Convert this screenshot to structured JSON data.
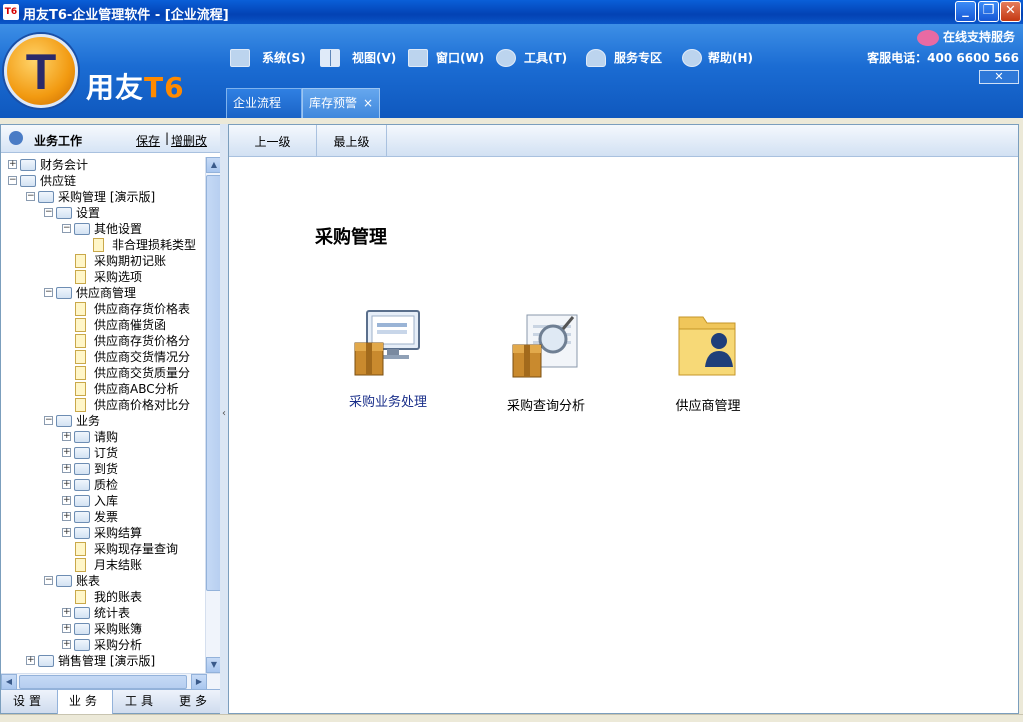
{
  "window": {
    "app_icon": "T6",
    "title": "用友T6-企业管理软件 - [企业流程]",
    "min_icon": "minimize-icon",
    "max_icon": "restore-icon",
    "close_icon": "close-icon"
  },
  "header": {
    "logo_letter": "T",
    "logo_text": "用友",
    "logo_text_brand": "T6",
    "menus": [
      {
        "label": "系统(S)",
        "icon": "monitor-icon"
      },
      {
        "label": "视图(V)",
        "icon": "grid-icon"
      },
      {
        "label": "窗口(W)",
        "icon": "window-icon"
      },
      {
        "label": "工具(T)",
        "icon": "gear-icon"
      },
      {
        "label": "服务专区",
        "icon": "user-icon"
      },
      {
        "label": "帮助(H)",
        "icon": "help-icon"
      }
    ],
    "online_service": "在线支持服务",
    "hotline": "客服电话：400 6600 566",
    "close_label": "✕"
  },
  "tabs": [
    {
      "label": "企业流程",
      "active": true
    },
    {
      "label": "库存预警",
      "active": false,
      "close": "×"
    }
  ],
  "left_panel": {
    "title": "业务工作",
    "save": "保存",
    "separator": "|",
    "edit": "增删改",
    "tree": [
      {
        "label": "财务会计",
        "level": 0,
        "expand": "+",
        "icon": "folder"
      },
      {
        "label": "供应链",
        "level": 0,
        "expand": "−",
        "icon": "folder"
      },
      {
        "label": "采购管理 [演示版]",
        "level": 1,
        "expand": "−",
        "icon": "folder"
      },
      {
        "label": "设置",
        "level": 2,
        "expand": "−",
        "icon": "folder"
      },
      {
        "label": "其他设置",
        "level": 3,
        "expand": "−",
        "icon": "folder"
      },
      {
        "label": "非合理损耗类型",
        "level": 4,
        "expand": "",
        "icon": "doc"
      },
      {
        "label": "采购期初记账",
        "level": 3,
        "expand": "",
        "icon": "doc"
      },
      {
        "label": "采购选项",
        "level": 3,
        "expand": "",
        "icon": "doc"
      },
      {
        "label": "供应商管理",
        "level": 2,
        "expand": "−",
        "icon": "folder"
      },
      {
        "label": "供应商存货价格表",
        "level": 3,
        "expand": "",
        "icon": "doc"
      },
      {
        "label": "供应商催货函",
        "level": 3,
        "expand": "",
        "icon": "doc"
      },
      {
        "label": "供应商存货价格分",
        "level": 3,
        "expand": "",
        "icon": "doc"
      },
      {
        "label": "供应商交货情况分",
        "level": 3,
        "expand": "",
        "icon": "doc"
      },
      {
        "label": "供应商交货质量分",
        "level": 3,
        "expand": "",
        "icon": "doc"
      },
      {
        "label": "供应商ABC分析",
        "level": 3,
        "expand": "",
        "icon": "doc"
      },
      {
        "label": "供应商价格对比分",
        "level": 3,
        "expand": "",
        "icon": "doc"
      },
      {
        "label": "业务",
        "level": 2,
        "expand": "−",
        "icon": "folder"
      },
      {
        "label": "请购",
        "level": 3,
        "expand": "+",
        "icon": "folder"
      },
      {
        "label": "订货",
        "level": 3,
        "expand": "+",
        "icon": "folder"
      },
      {
        "label": "到货",
        "level": 3,
        "expand": "+",
        "icon": "folder"
      },
      {
        "label": "质检",
        "level": 3,
        "expand": "+",
        "icon": "folder"
      },
      {
        "label": "入库",
        "level": 3,
        "expand": "+",
        "icon": "folder"
      },
      {
        "label": "发票",
        "level": 3,
        "expand": "+",
        "icon": "folder"
      },
      {
        "label": "采购结算",
        "level": 3,
        "expand": "+",
        "icon": "folder"
      },
      {
        "label": "采购现存量查询",
        "level": 3,
        "expand": "",
        "icon": "doc"
      },
      {
        "label": "月末结账",
        "level": 3,
        "expand": "",
        "icon": "doc"
      },
      {
        "label": "账表",
        "level": 2,
        "expand": "−",
        "icon": "folder"
      },
      {
        "label": "我的账表",
        "level": 3,
        "expand": "",
        "icon": "doc"
      },
      {
        "label": "统计表",
        "level": 3,
        "expand": "+",
        "icon": "folder"
      },
      {
        "label": "采购账簿",
        "level": 3,
        "expand": "+",
        "icon": "folder"
      },
      {
        "label": "采购分析",
        "level": 3,
        "expand": "+",
        "icon": "folder"
      },
      {
        "label": "销售管理 [演示版]",
        "level": 1,
        "expand": "+",
        "icon": "folder"
      }
    ],
    "bottom_tabs": [
      {
        "label": "设置",
        "active": false
      },
      {
        "label": "业务",
        "active": true
      },
      {
        "label": "工具",
        "active": false
      },
      {
        "label": "更多",
        "active": false
      }
    ]
  },
  "main": {
    "nav": [
      "上一级",
      "最上级"
    ],
    "title": "采购管理",
    "tiles": [
      {
        "label": "采购业务处理",
        "icon": "purchase-process-icon"
      },
      {
        "label": "采购查询分析",
        "icon": "purchase-query-icon"
      },
      {
        "label": "供应商管理",
        "icon": "supplier-folder-icon"
      }
    ]
  },
  "colors": {
    "title_blue": "#0342b4",
    "header_blue": "#1b6cd3",
    "accent_orange": "#f29a11",
    "link_blue": "#1a2f8a"
  }
}
